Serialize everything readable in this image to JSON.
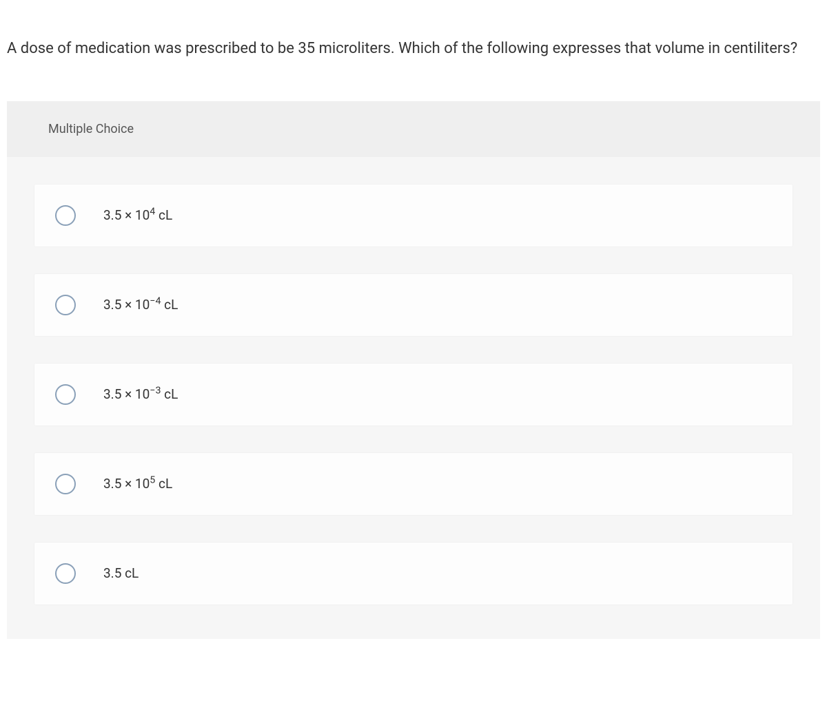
{
  "question": "A dose of medication was prescribed to be 35 microliters. Which of the following expresses that volume in centiliters?",
  "section_label": "Multiple Choice",
  "options": [
    {
      "base": "3.5 × 10",
      "exp": "4",
      "unit": " cL"
    },
    {
      "base": "3.5 × 10",
      "exp": "−4",
      "unit": " cL"
    },
    {
      "base": "3.5 × 10",
      "exp": "−3",
      "unit": " cL"
    },
    {
      "base": "3.5 × 10",
      "exp": "5",
      "unit": " cL"
    },
    {
      "base": "3.5 cL",
      "exp": "",
      "unit": ""
    }
  ]
}
